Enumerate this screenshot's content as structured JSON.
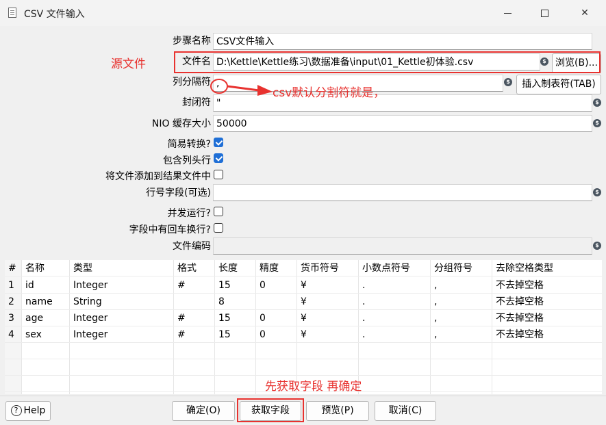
{
  "window": {
    "title": "CSV 文件输入"
  },
  "form": {
    "step_name_label": "步骤名称",
    "step_name_value": "CSV文件输入",
    "filename_label": "文件名",
    "filename_value": "D:\\Kettle\\Kettle练习\\数据准备\\input\\01_Kettle初体验.csv",
    "browse_label": "浏览(B)...",
    "delimiter_label": "列分隔符",
    "delimiter_value": ",",
    "insert_tab_label": "插入制表符(TAB)",
    "enclosure_label": "封闭符",
    "enclosure_value": "\"",
    "nio_label": "NIO 缓存大小",
    "nio_value": "50000",
    "lazy_label": "简易转换?",
    "header_label": "包含列头行",
    "add_file_label": "将文件添加到结果文件中",
    "rownum_label": "行号字段(可选)",
    "rownum_value": "",
    "parallel_label": "并发运行?",
    "newline_label": "字段中有回车换行?",
    "encoding_label": "文件编码",
    "encoding_value": ""
  },
  "checkboxes": {
    "lazy": true,
    "header": true,
    "add_file": false,
    "parallel": false,
    "newline": false
  },
  "table": {
    "headers": [
      "#",
      "名称",
      "类型",
      "格式",
      "长度",
      "精度",
      "货币符号",
      "小数点符号",
      "分组符号",
      "去除空格类型"
    ],
    "rows": [
      [
        "1",
        "id",
        "Integer",
        "#",
        "15",
        "0",
        "¥",
        ".",
        ",",
        "不去掉空格"
      ],
      [
        "2",
        "name",
        "String",
        "",
        "8",
        "",
        "¥",
        ".",
        ",",
        "不去掉空格"
      ],
      [
        "3",
        "age",
        "Integer",
        "#",
        "15",
        "0",
        "¥",
        ".",
        ",",
        "不去掉空格"
      ],
      [
        "4",
        "sex",
        "Integer",
        "#",
        "15",
        "0",
        "¥",
        ".",
        ",",
        "不去掉空格"
      ]
    ]
  },
  "buttons": {
    "help": "Help",
    "ok": "确定(O)",
    "get_fields": "获取字段",
    "preview": "预览(P)",
    "cancel": "取消(C)"
  },
  "annotations": {
    "source_file": "源文件",
    "csv_default": "csv默认分割符就是，",
    "get_first": "先获取字段 再确定"
  },
  "colors": {
    "annotation": "#e8322f",
    "checkbox_checked": "#1f6fd6"
  }
}
